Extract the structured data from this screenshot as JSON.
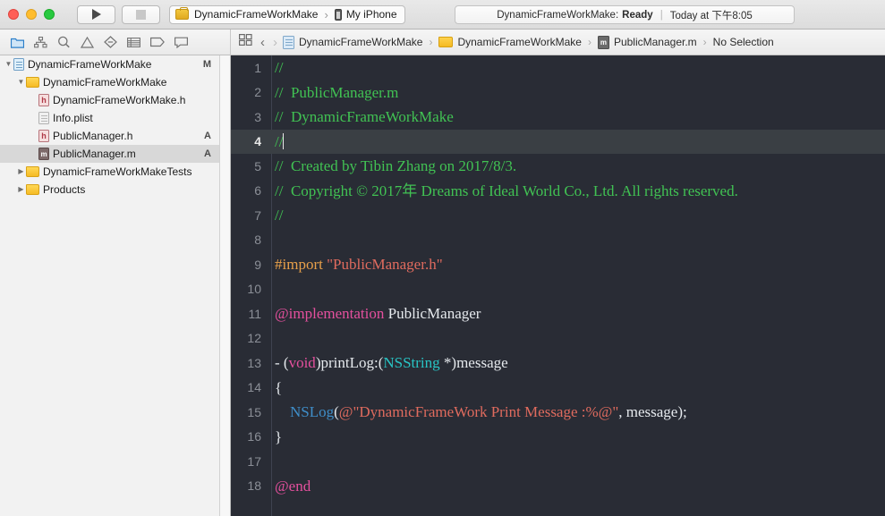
{
  "titlebar": {
    "traffic_lights": [
      "close",
      "minimize",
      "zoom"
    ],
    "run_button": "run-icon",
    "stop_button": "stop-icon",
    "scheme": "DynamicFrameWorkMake",
    "destination": "My iPhone",
    "scheme_separator": "›",
    "status_project": "DynamicFrameWorkMake:",
    "status_state": "Ready",
    "status_divider": "|",
    "status_time": "Today at 下午8:05"
  },
  "toolbar": {
    "nav_icons": [
      "folder-icon",
      "hierarchy-icon",
      "search-icon",
      "warning-icon",
      "diamond-icon",
      "test-icon",
      "tag-icon",
      "comment-icon"
    ],
    "panel_toggle": "editor-layout-icon",
    "back": "‹",
    "forward": "›",
    "breadcrumb_chevron": "›",
    "breadcrumb": [
      {
        "label": "DynamicFrameWorkMake",
        "icon": "project-icon"
      },
      {
        "label": "DynamicFrameWorkMake",
        "icon": "folder-icon"
      },
      {
        "label": "PublicManager.m",
        "icon": "objc-file-icon"
      },
      {
        "label": "No Selection",
        "icon": ""
      }
    ]
  },
  "sidebar": {
    "disclosure_open": "▼",
    "disclosure_closed": "▶",
    "items": [
      {
        "label": "DynamicFrameWorkMake",
        "icon": "project-icon",
        "indent": 0,
        "disclosure": "open",
        "badge": "M",
        "selected": false
      },
      {
        "label": "DynamicFrameWorkMake",
        "icon": "folder-icon",
        "indent": 1,
        "disclosure": "open",
        "badge": "",
        "selected": false
      },
      {
        "label": "DynamicFrameWorkMake.h",
        "icon": "header-file-icon",
        "indent": 2,
        "disclosure": "none",
        "badge": "",
        "selected": false
      },
      {
        "label": "Info.plist",
        "icon": "plist-file-icon",
        "indent": 2,
        "disclosure": "none",
        "badge": "",
        "selected": false
      },
      {
        "label": "PublicManager.h",
        "icon": "header-file-icon",
        "indent": 2,
        "disclosure": "none",
        "badge": "A",
        "selected": false
      },
      {
        "label": "PublicManager.m",
        "icon": "objc-file-icon",
        "indent": 2,
        "disclosure": "none",
        "badge": "A",
        "selected": true
      },
      {
        "label": "DynamicFrameWorkMakeTests",
        "icon": "folder-icon",
        "indent": 1,
        "disclosure": "closed",
        "badge": "",
        "selected": false
      },
      {
        "label": "Products",
        "icon": "folder-icon",
        "indent": 1,
        "disclosure": "closed",
        "badge": "",
        "selected": false
      }
    ]
  },
  "editor": {
    "active_line": 4,
    "lines": [
      {
        "n": 1,
        "tokens": [
          {
            "t": "//",
            "c": "c-comment"
          }
        ]
      },
      {
        "n": 2,
        "tokens": [
          {
            "t": "//  PublicManager.m",
            "c": "c-comment"
          }
        ]
      },
      {
        "n": 3,
        "tokens": [
          {
            "t": "//  DynamicFrameWorkMake",
            "c": "c-comment"
          }
        ]
      },
      {
        "n": 4,
        "tokens": [
          {
            "t": "//",
            "c": "c-comment"
          }
        ],
        "caret": true
      },
      {
        "n": 5,
        "tokens": [
          {
            "t": "//  Created by Tibin Zhang on 2017/8/3.",
            "c": "c-comment"
          }
        ]
      },
      {
        "n": 6,
        "tokens": [
          {
            "t": "//  Copyright © 2017年 Dreams of Ideal World Co., Ltd. All rights reserved.",
            "c": "c-comment"
          }
        ]
      },
      {
        "n": 7,
        "tokens": [
          {
            "t": "//",
            "c": "c-comment"
          }
        ]
      },
      {
        "n": 8,
        "tokens": [
          {
            "t": "",
            "c": "c-plain"
          }
        ]
      },
      {
        "n": 9,
        "tokens": [
          {
            "t": "#import ",
            "c": "c-pre"
          },
          {
            "t": "\"PublicManager.h\"",
            "c": "c-string"
          }
        ]
      },
      {
        "n": 10,
        "tokens": [
          {
            "t": "",
            "c": "c-plain"
          }
        ]
      },
      {
        "n": 11,
        "tokens": [
          {
            "t": "@implementation",
            "c": "c-key"
          },
          {
            "t": " PublicManager",
            "c": "c-plain"
          }
        ]
      },
      {
        "n": 12,
        "tokens": [
          {
            "t": "",
            "c": "c-plain"
          }
        ]
      },
      {
        "n": 13,
        "tokens": [
          {
            "t": "- (",
            "c": "c-plain"
          },
          {
            "t": "void",
            "c": "c-key"
          },
          {
            "t": ")printLog:(",
            "c": "c-plain"
          },
          {
            "t": "NSString",
            "c": "c-type"
          },
          {
            "t": " *)message",
            "c": "c-plain"
          }
        ]
      },
      {
        "n": 14,
        "tokens": [
          {
            "t": "{",
            "c": "c-plain"
          }
        ]
      },
      {
        "n": 15,
        "tokens": [
          {
            "t": "    ",
            "c": "c-plain"
          },
          {
            "t": "NSLog",
            "c": "c-fn"
          },
          {
            "t": "(",
            "c": "c-plain"
          },
          {
            "t": "@\"DynamicFrameWork Print Message :%@\"",
            "c": "c-string"
          },
          {
            "t": ", message);",
            "c": "c-plain"
          }
        ]
      },
      {
        "n": 16,
        "tokens": [
          {
            "t": "}",
            "c": "c-plain"
          }
        ]
      },
      {
        "n": 17,
        "tokens": [
          {
            "t": "",
            "c": "c-plain"
          }
        ]
      },
      {
        "n": 18,
        "tokens": [
          {
            "t": "@end",
            "c": "c-key"
          }
        ]
      }
    ]
  }
}
